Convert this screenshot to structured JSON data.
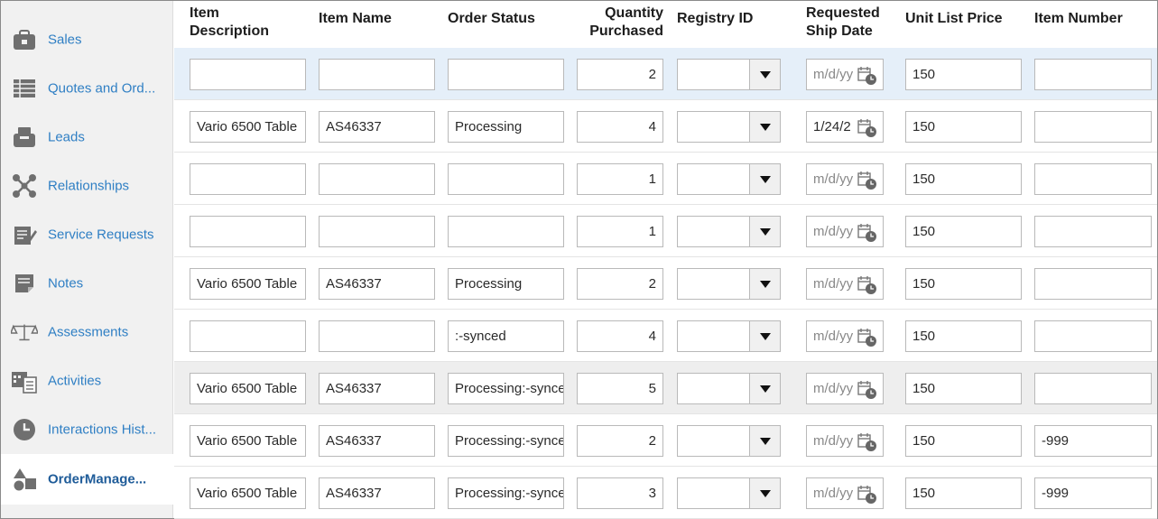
{
  "sidebar": {
    "items": [
      {
        "label": "Sales",
        "icon": "briefcase-icon"
      },
      {
        "label": "Quotes and Ord...",
        "icon": "spreadsheet-icon"
      },
      {
        "label": "Leads",
        "icon": "inbox-tray-icon"
      },
      {
        "label": "Relationships",
        "icon": "network-icon"
      },
      {
        "label": "Service Requests",
        "icon": "clipboard-edit-icon"
      },
      {
        "label": "Notes",
        "icon": "note-icon"
      },
      {
        "label": "Assessments",
        "icon": "scale-icon"
      },
      {
        "label": "Activities",
        "icon": "calendar-list-icon"
      },
      {
        "label": "Interactions Hist...",
        "icon": "clock-icon"
      },
      {
        "label": "OrderManage...",
        "icon": "shapes-icon",
        "active": true
      }
    ]
  },
  "table": {
    "headers": {
      "item_description": "Item Description",
      "item_name": "Item Name",
      "order_status": "Order Status",
      "quantity_purchased": "Quantity Purchased",
      "registry_id": "Registry ID",
      "requested_ship_date": "Requested Ship Date",
      "unit_list_price": "Unit List Price",
      "item_number": "Item Number"
    },
    "date_placeholder": "m/d/yy",
    "rows": [
      {
        "item_description": "",
        "item_name": "",
        "order_status": "",
        "quantity": "2",
        "registry_id": "",
        "ship_date": "m/d/yy",
        "unit_list_price": "150",
        "item_number": ""
      },
      {
        "item_description": "Vario 6500 Table",
        "item_name": "AS46337",
        "order_status": "Processing",
        "quantity": "4",
        "registry_id": "",
        "ship_date": "1/24/2",
        "unit_list_price": "150",
        "item_number": ""
      },
      {
        "item_description": "",
        "item_name": "",
        "order_status": "",
        "quantity": "1",
        "registry_id": "",
        "ship_date": "m/d/yy",
        "unit_list_price": "150",
        "item_number": ""
      },
      {
        "item_description": "",
        "item_name": "",
        "order_status": "",
        "quantity": "1",
        "registry_id": "",
        "ship_date": "m/d/yy",
        "unit_list_price": "150",
        "item_number": ""
      },
      {
        "item_description": "Vario 6500 Table",
        "item_name": "AS46337",
        "order_status": "Processing",
        "quantity": "2",
        "registry_id": "",
        "ship_date": "m/d/yy",
        "unit_list_price": "150",
        "item_number": ""
      },
      {
        "item_description": "",
        "item_name": "",
        "order_status": ":-synced",
        "quantity": "4",
        "registry_id": "",
        "ship_date": "m/d/yy",
        "unit_list_price": "150",
        "item_number": ""
      },
      {
        "item_description": "Vario 6500 Table",
        "item_name": "AS46337",
        "order_status": "Processing:-synced",
        "quantity": "5",
        "registry_id": "",
        "ship_date": "m/d/yy",
        "unit_list_price": "150",
        "item_number": ""
      },
      {
        "item_description": "Vario 6500 Table",
        "item_name": "AS46337",
        "order_status": "Processing:-synced",
        "quantity": "2",
        "registry_id": "",
        "ship_date": "m/d/yy",
        "unit_list_price": "150",
        "item_number": "-999"
      },
      {
        "item_description": "Vario 6500 Table",
        "item_name": "AS46337",
        "order_status": "Processing:-synced",
        "quantity": "3",
        "registry_id": "",
        "ship_date": "m/d/yy",
        "unit_list_price": "150",
        "item_number": "-999"
      }
    ]
  },
  "colors": {
    "link_blue": "#2f7fc4",
    "active_blue": "#1f5c99",
    "selected_row": "#e5eff9",
    "hover_row": "#eeeeee",
    "sidebar_bg": "#f1f1f1"
  }
}
